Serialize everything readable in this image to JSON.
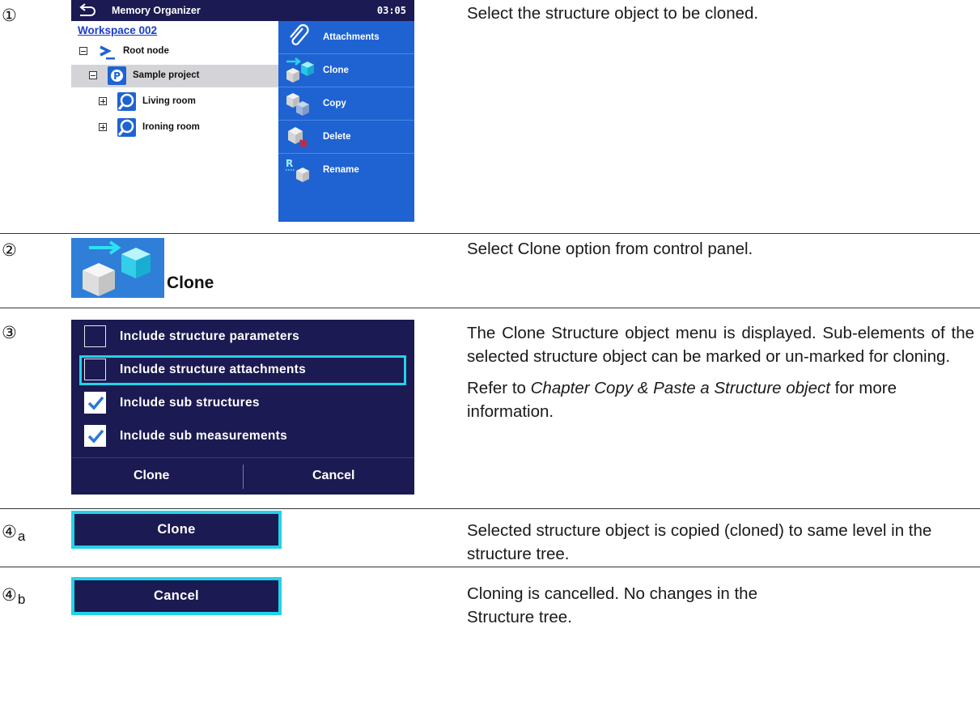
{
  "steps": {
    "s1": {
      "num": "①",
      "desc": "Select the structure object to be cloned."
    },
    "s2": {
      "num": "②",
      "desc": "Select Clone option from control panel.",
      "icon_caption": "Clone"
    },
    "s3": {
      "num": "③",
      "desc1": "The Clone Structure object menu is displayed. Sub-elements of the selected structure object can be marked or un-marked for cloning.",
      "desc2_pre": "Refer to ",
      "desc2_em": "Chapter Copy & Paste a Structure object",
      "desc2_post": " for more information."
    },
    "s4a": {
      "num": "④",
      "sub": "a",
      "desc": "Selected structure object is copied (cloned) to same level in the structure tree."
    },
    "s4b": {
      "num": "④",
      "sub": "b",
      "desc": "Cloning is cancelled. No changes in the Structure tree."
    }
  },
  "device": {
    "title": "Memory Organizer",
    "clock": "03:05",
    "workspace": "Workspace 002",
    "tree": [
      {
        "label": "Root node"
      },
      {
        "label": "Sample project"
      },
      {
        "label": "Living room"
      },
      {
        "label": "Ironing room"
      }
    ],
    "panel": [
      {
        "label": "Attachments"
      },
      {
        "label": "Clone"
      },
      {
        "label": "Copy"
      },
      {
        "label": "Delete"
      },
      {
        "label": "Rename"
      }
    ]
  },
  "dialog": {
    "options": [
      {
        "label": "Include structure parameters",
        "checked": false
      },
      {
        "label": "Include structure attachments",
        "checked": false
      },
      {
        "label": "Include sub structures",
        "checked": true
      },
      {
        "label": "Include sub measurements",
        "checked": true
      }
    ],
    "clone_label": "Clone",
    "cancel_label": "Cancel"
  },
  "buttons": {
    "clone": "Clone",
    "cancel": "Cancel"
  },
  "colors": {
    "dark_navy": "#1b1a52",
    "panel_blue": "#1f63d3",
    "highlight_cyan": "#22d3e8",
    "link_blue": "#1a3cd0"
  }
}
